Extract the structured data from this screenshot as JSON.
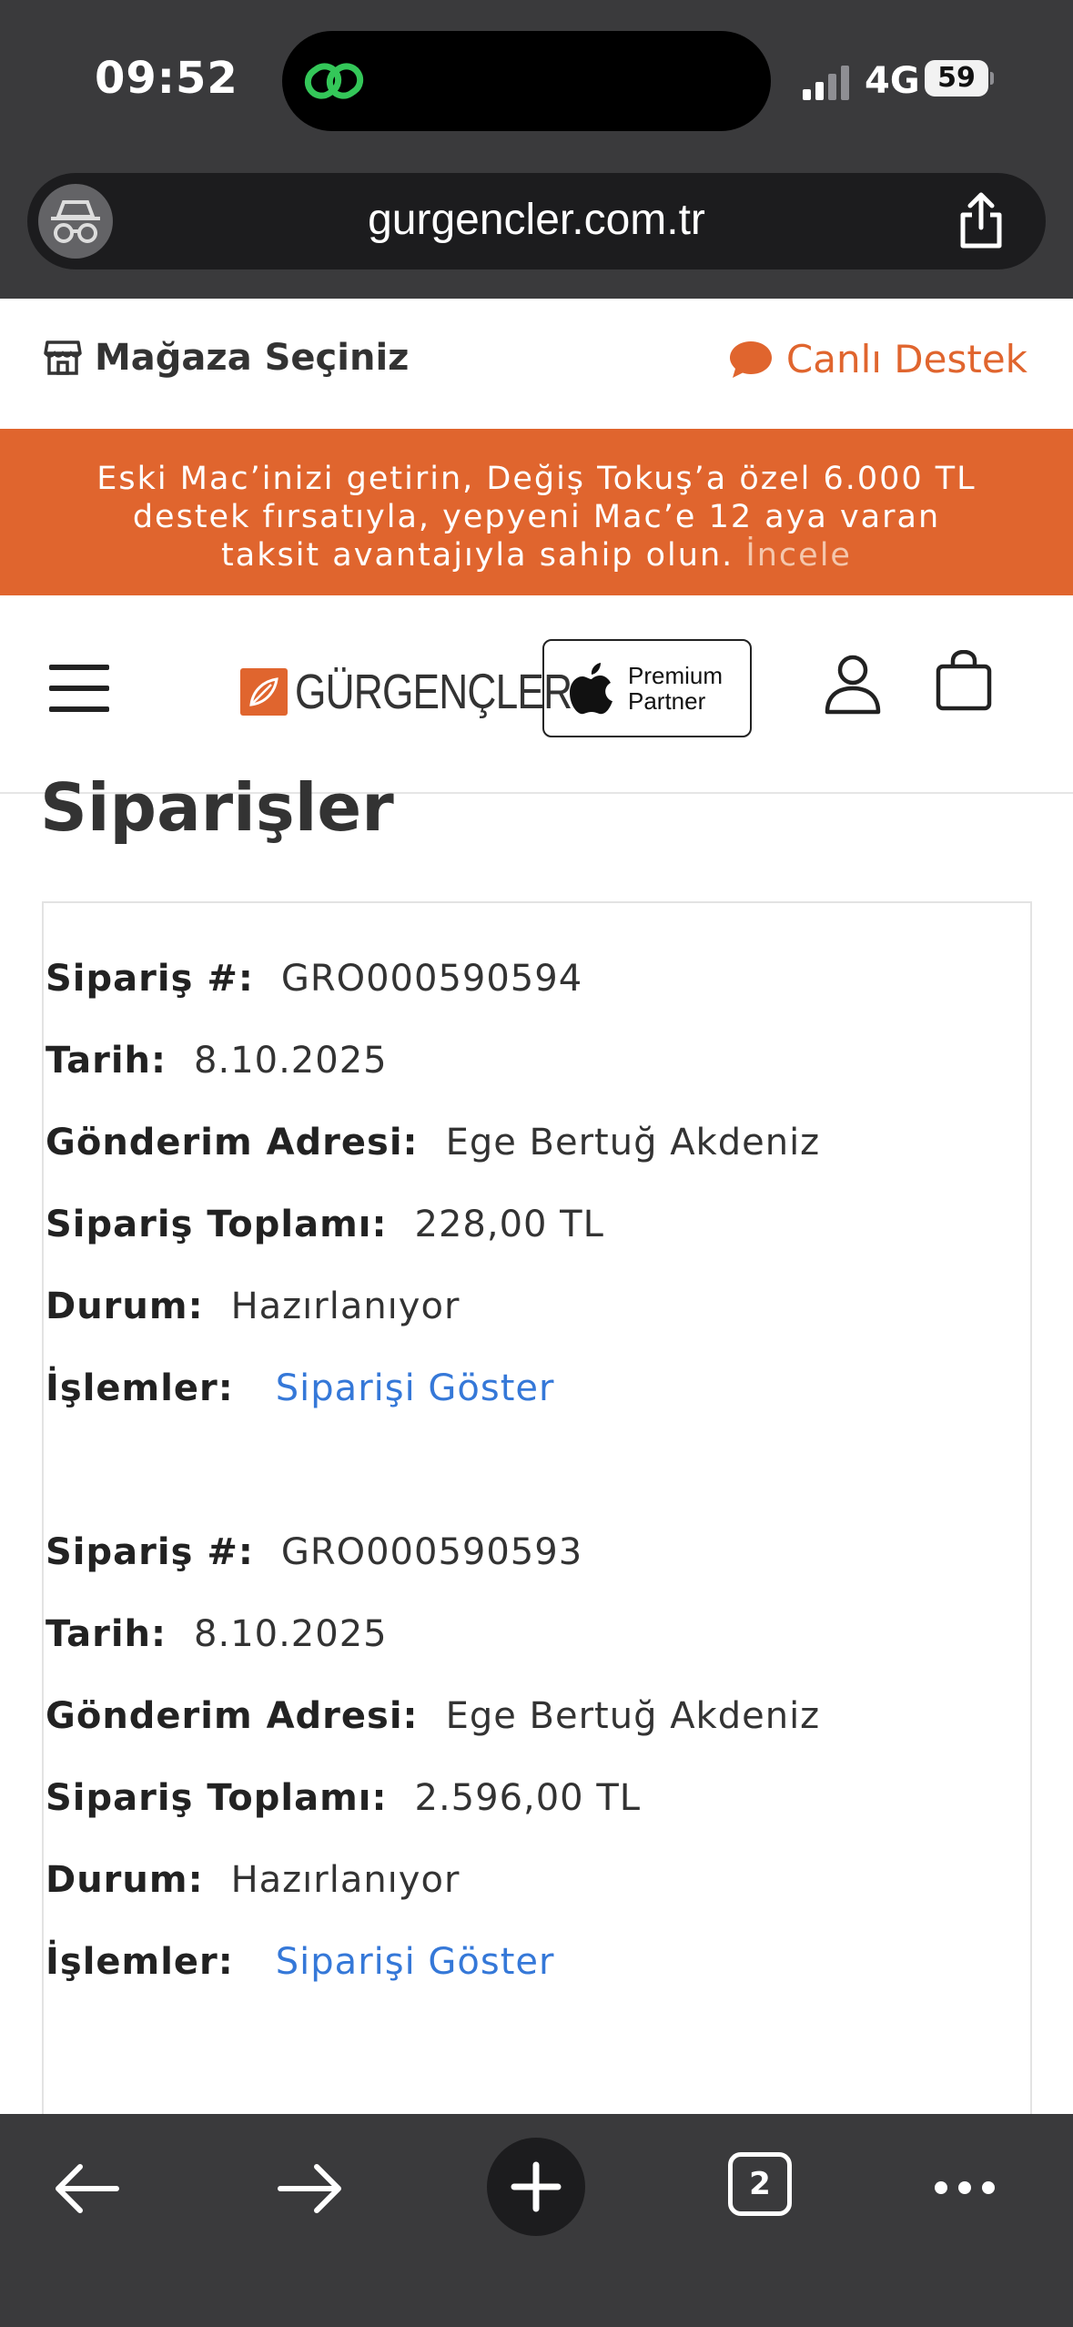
{
  "status_bar": {
    "time": "09:52",
    "network": "4G",
    "battery": "59"
  },
  "browser": {
    "url": "gurgencler.com.tr",
    "tabs_count": "2"
  },
  "store_bar": {
    "store_label": "Mağaza Seçiniz",
    "live_support": "Canlı Destek"
  },
  "promo": {
    "line1": "Eski Mac’inizi getirin, Değiş Tokuş’a özel 6.000 TL",
    "line2": "destek fırsatıyla, yepyeni Mac’e 12 aya varan",
    "line3": "taksit avantajıyla sahip olun.",
    "link": "İncele"
  },
  "header": {
    "logo": "GÜRGENÇLER",
    "partner_line1": "Premium",
    "partner_line2": "Partner"
  },
  "page": {
    "title": "Siparişler"
  },
  "labels": {
    "order_no": "Sipariş #:",
    "date": "Tarih:",
    "address": "Gönderim Adresi:",
    "total": "Sipariş Toplamı:",
    "status": "Durum:",
    "actions": "İşlemler:"
  },
  "orders": [
    {
      "number": "GRO000590594",
      "date": "8.10.2025",
      "address": "Ege Bertuğ Akdeniz",
      "total": "228,00 TL",
      "status": "Hazırlanıyor",
      "action": "Siparişi Göster"
    },
    {
      "number": "GRO000590593",
      "date": "8.10.2025",
      "address": "Ege Bertuğ Akdeniz",
      "total": "2.596,00 TL",
      "status": "Hazırlanıyor",
      "action": "Siparişi Göster"
    }
  ],
  "colors": {
    "accent": "#e0652e",
    "link": "#3578d8",
    "chrome": "#3a3a3c"
  },
  "icons": [
    "incognito-icon",
    "share-icon",
    "store-icon",
    "chat-bubble-icon",
    "hamburger-icon",
    "apple-icon",
    "user-icon",
    "bag-icon",
    "back-arrow-icon",
    "forward-arrow-icon",
    "plus-icon",
    "tabs-icon",
    "more-icon"
  ]
}
